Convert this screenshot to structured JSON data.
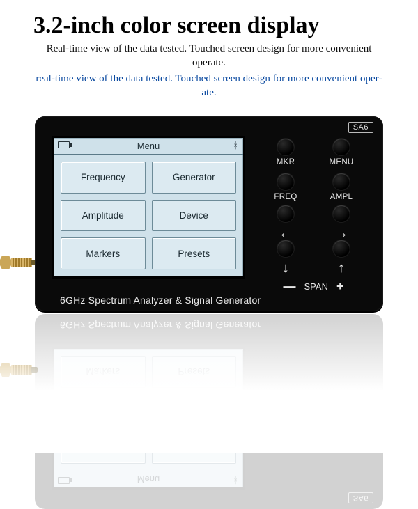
{
  "headline": "3.2-inch color screen display",
  "subtitle_black": "Real-time view of the data tested.  Touched screen design for more con­venient operate.",
  "subtitle_blue": "real-time view of the data tested.  Touched screen design for more convenient oper­ate.",
  "device": {
    "badge": "SA6",
    "bottom_label": "6GHz Spectrum Analyzer & Signal Generator"
  },
  "screen": {
    "title": "Menu",
    "buttons": [
      "Frequency",
      "Generator",
      "Amplitude",
      "Device",
      "Markers",
      "Presets"
    ],
    "battery_icon": "battery",
    "bt_icon": "bluetooth"
  },
  "controls": {
    "row1": [
      "MKR",
      "MENU"
    ],
    "row2": [
      "FREQ",
      "AMPL"
    ],
    "arrows_row1": [
      "←",
      "→"
    ],
    "arrows_row2": [
      "↓",
      "↑"
    ],
    "span": {
      "minus": "—",
      "label": "SPAN",
      "plus": "+"
    }
  }
}
